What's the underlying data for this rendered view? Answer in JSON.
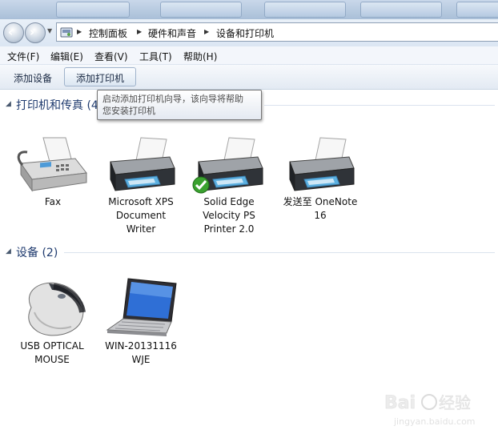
{
  "colors": {
    "accent": "#1e3a6e",
    "toolbar": "#dbe6f3",
    "tooltip_border": "#767676"
  },
  "address_bar": {
    "icon": "control-panel-icon",
    "breadcrumbs": [
      "控制面板",
      "硬件和声音",
      "设备和打印机"
    ]
  },
  "menu": {
    "items": [
      "文件(F)",
      "编辑(E)",
      "查看(V)",
      "工具(T)",
      "帮助(H)"
    ]
  },
  "toolbar": {
    "add_device": "添加设备",
    "add_printer": "添加打印机"
  },
  "tooltip": {
    "text": "启动添加打印机向导，该向导将帮助\n您安装打印机"
  },
  "printers_group": {
    "title": "打印机和传真 (4)",
    "items": [
      {
        "label": "Fax",
        "icon": "fax-icon",
        "default": false
      },
      {
        "label": "Microsoft XPS\nDocument\nWriter",
        "icon": "printer-icon",
        "default": false
      },
      {
        "label": "Solid Edge\nVelocity PS\nPrinter 2.0",
        "icon": "printer-icon",
        "default": true
      },
      {
        "label": "发送至 OneNote\n16",
        "icon": "printer-icon",
        "default": false
      }
    ]
  },
  "devices_group": {
    "title": "设备 (2)",
    "items": [
      {
        "label": "USB OPTICAL\nMOUSE",
        "icon": "mouse-icon"
      },
      {
        "label": "WIN-20131116\nWJE",
        "icon": "laptop-icon"
      }
    ]
  },
  "watermark": {
    "brand": "Baidu经验",
    "url": "jingyan.baidu.com"
  }
}
